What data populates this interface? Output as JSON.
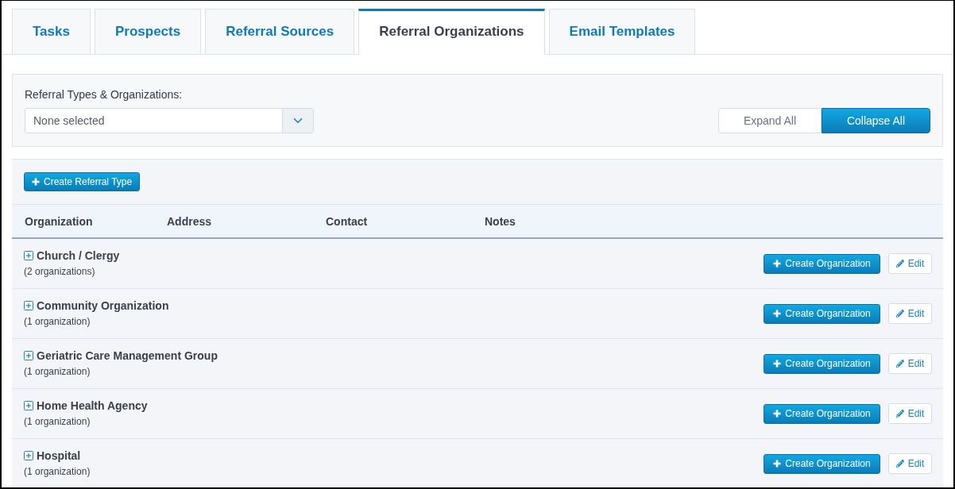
{
  "tabs": [
    {
      "label": "Tasks",
      "selected": false
    },
    {
      "label": "Prospects",
      "selected": false
    },
    {
      "label": "Referral Sources",
      "selected": false
    },
    {
      "label": "Referral Organizations",
      "selected": true
    },
    {
      "label": "Email Templates",
      "selected": false
    }
  ],
  "filter": {
    "label": "Referral Types & Organizations:",
    "select": {
      "value": "None selected"
    },
    "buttons": [
      {
        "label": "Expand All",
        "selected": false
      },
      {
        "label": "Collapse All",
        "selected": true
      }
    ]
  },
  "toolbar": {
    "create_button": "Create Referral Type"
  },
  "table": {
    "columns": [
      "Organization",
      "Address",
      "Contact",
      "Notes"
    ],
    "rows": [
      {
        "name": "Church / Clergy",
        "count": "(2 organizations)",
        "expanded": false,
        "create_button": "Create Organization",
        "edit_button": "Edit"
      },
      {
        "name": "Community Organization",
        "count": "(1 organization)",
        "expanded": false,
        "create_button": "Create Organization",
        "edit_button": "Edit"
      },
      {
        "name": "Geriatric Care Management Group",
        "count": "(1 organization)",
        "expanded": false,
        "create_button": "Create Organization",
        "edit_button": "Edit"
      },
      {
        "name": "Home Health Agency",
        "count": "(1 organization)",
        "expanded": false,
        "create_button": "Create Organization",
        "edit_button": "Edit"
      },
      {
        "name": "Hospital",
        "count": "(1 organization)",
        "expanded": false,
        "create_button": "Create Organization",
        "edit_button": "Edit"
      }
    ]
  }
}
